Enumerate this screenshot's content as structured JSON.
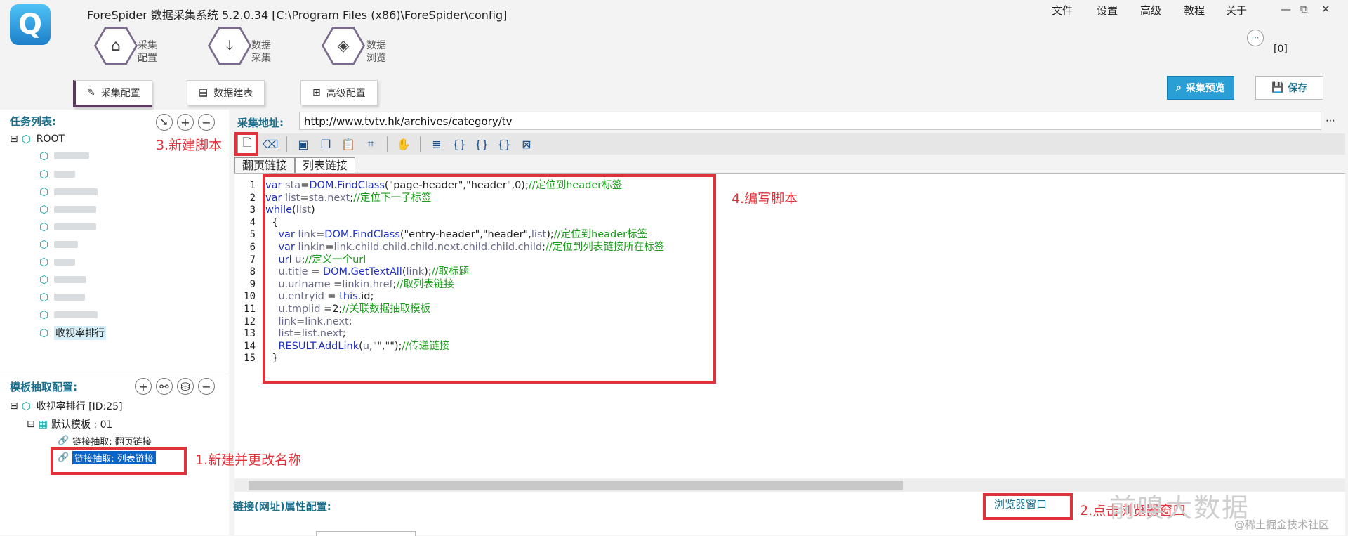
{
  "window": {
    "title": "ForeSpider 数据采集系统   5.2.0.34   [C:\\Program Files (x86)\\ForeSpider\\config]",
    "logo_text": "Q",
    "menu": [
      "文件",
      "设置",
      "高级",
      "教程",
      "关于"
    ],
    "controls": [
      "—",
      "⧉",
      "✕"
    ],
    "message_count": "[0]"
  },
  "main_tabs": [
    {
      "label": "采集\n配置",
      "icon": "home-icon"
    },
    {
      "label": "数据\n采集",
      "icon": "download-icon"
    },
    {
      "label": "数据\n浏览",
      "icon": "layers-icon"
    }
  ],
  "sub_tabs": [
    "采集配置",
    "数据建表",
    "高级配置"
  ],
  "actions": {
    "preview": "采集预览",
    "save": "保存"
  },
  "task_panel": {
    "title": "任务列表:",
    "root": "ROOT",
    "last_item": "收视率排行"
  },
  "template_panel": {
    "title": "模板抽取配置:",
    "node1": "收视率排行 [ID:25]",
    "node2": "默认模板 : 01",
    "node3": "链接抽取: 翻页链接",
    "node4": "链接抽取: 列表链接"
  },
  "url": {
    "label": "采集地址:",
    "value": "http://www.tvtv.hk/archives/category/tv"
  },
  "code_tabs": [
    "翻页链接",
    "列表链接"
  ],
  "line_numbers": [
    "1",
    "2",
    "3",
    "4",
    "5",
    "6",
    "7",
    "8",
    "9",
    "10",
    "11",
    "12",
    "13",
    "14",
    "15"
  ],
  "bottom": {
    "title": "链接(网址)属性配置:",
    "browser_button": "浏览器窗口"
  },
  "annotations": {
    "new_script": "3.新建脚本",
    "write_script": "4.编写脚本",
    "rename": "1.新建并更改名称",
    "click": "2.点击浏览器窗口"
  },
  "watermark": {
    "main": "前嗅大数据",
    "sub": "@稀土掘金技术社区"
  },
  "colors": {
    "accent": "#1b6f8a",
    "highlight": "#e0323a",
    "selection": "#0a64c8"
  }
}
